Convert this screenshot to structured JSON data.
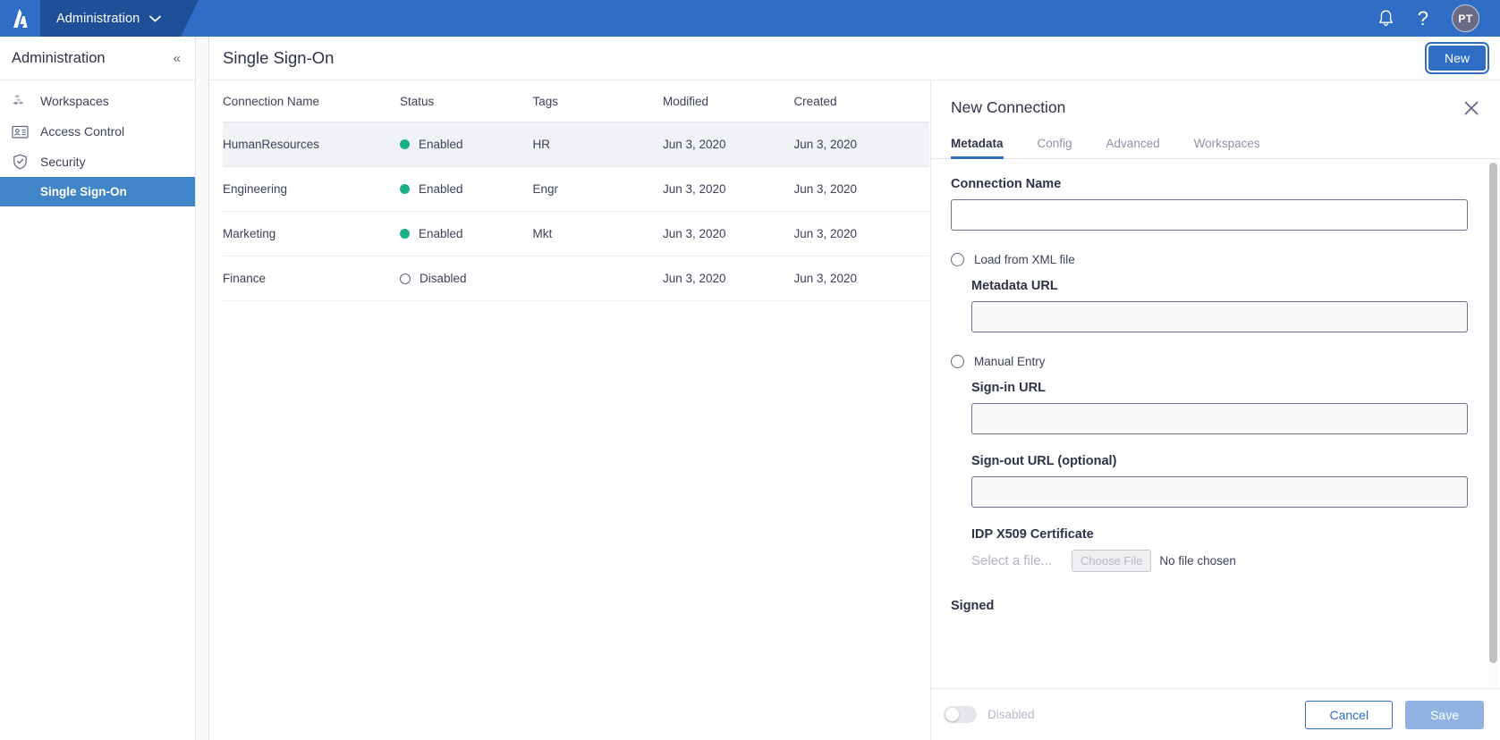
{
  "topbar": {
    "logo_icon": "aveva-logo-icon",
    "app_name": "Administration",
    "chevron_icon": "chevron-down-icon",
    "bell_icon": "notification-bell-icon",
    "help_icon": "help-question-icon",
    "help_glyph": "?",
    "avatar_initials": "PT",
    "brand_color": "#2f6ec4",
    "app_switcher_color": "#1f4f96"
  },
  "sidebar": {
    "title": "Administration",
    "collapse_icon": "collapse-chevrons-icon",
    "collapse_glyph": "«",
    "items": [
      {
        "label": "Workspaces",
        "icon": "workspaces-cubes-icon",
        "active": false
      },
      {
        "label": "Access Control",
        "icon": "access-control-id-card-icon",
        "active": false
      },
      {
        "label": "Security",
        "icon": "security-shield-check-icon",
        "active": false
      }
    ],
    "sub_item": {
      "label": "Single Sign-On",
      "active": true,
      "highlight_color": "#4086c7"
    }
  },
  "page": {
    "title": "Single Sign-On",
    "new_button": "New"
  },
  "table": {
    "columns": [
      "Connection Name",
      "Status",
      "Tags",
      "Modified",
      "Created"
    ],
    "rows": [
      {
        "name": "HumanResources",
        "status": "Enabled",
        "status_on": true,
        "tags": "HR",
        "modified": "Jun 3, 2020",
        "created": "Jun 3, 2020",
        "selected": true
      },
      {
        "name": "Engineering",
        "status": "Enabled",
        "status_on": true,
        "tags": "Engr",
        "modified": "Jun 3, 2020",
        "created": "Jun 3, 2020",
        "selected": false
      },
      {
        "name": "Marketing",
        "status": "Enabled",
        "status_on": true,
        "tags": "Mkt",
        "modified": "Jun 3, 2020",
        "created": "Jun 3, 2020",
        "selected": false
      },
      {
        "name": "Finance",
        "status": "Disabled",
        "status_on": false,
        "tags": "",
        "modified": "Jun 3, 2020",
        "created": "Jun 3, 2020",
        "selected": false
      }
    ],
    "enabled_dot_color": "#17b184"
  },
  "panel": {
    "title": "New Connection",
    "close_icon": "close-x-icon",
    "tabs": [
      {
        "label": "Metadata",
        "active": true
      },
      {
        "label": "Config",
        "active": false
      },
      {
        "label": "Advanced",
        "active": false
      },
      {
        "label": "Workspaces",
        "active": false
      }
    ],
    "active_tab_color": "#2f6ec4",
    "form": {
      "connection_name_label": "Connection Name",
      "connection_name_value": "",
      "connection_name_placeholder": "",
      "radio_xml_label": "Load from XML file",
      "radio_xml_selected": false,
      "metadata_url_label": "Metadata URL",
      "metadata_url_value": "",
      "radio_manual_label": "Manual Entry",
      "radio_manual_selected": false,
      "signin_url_label": "Sign-in URL",
      "signin_url_value": "",
      "signout_url_label": "Sign-out URL (optional)",
      "signout_url_value": "",
      "cert_label": "IDP X509 Certificate",
      "cert_placeholder": "Select a file...",
      "choose_file_label": "Choose File",
      "no_file_label": "No file chosen",
      "signed_label": "Signed"
    },
    "footer": {
      "toggle_state_label": "Disabled",
      "toggle_on": false,
      "cancel_label": "Cancel",
      "save_label": "Save"
    }
  }
}
